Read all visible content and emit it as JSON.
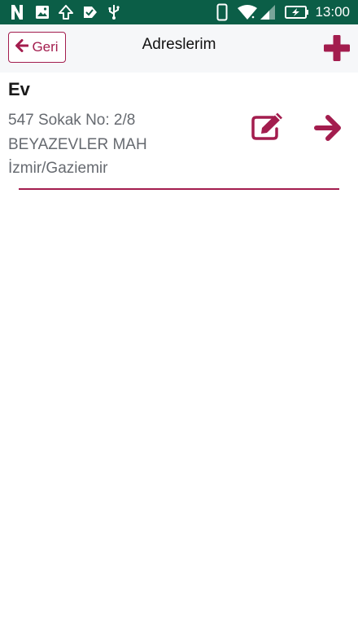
{
  "status_bar": {
    "time": "13:00",
    "icons": [
      "n-app-icon",
      "image-icon",
      "upload-icon",
      "check-app-icon",
      "usb-icon",
      "phone-icon",
      "wifi-icon",
      "signal-icon",
      "battery-charging-icon"
    ]
  },
  "header": {
    "back_label": "Geri",
    "title": "Adreslerim",
    "add_icon": "plus-icon"
  },
  "addresses": [
    {
      "name": "Ev",
      "line1": "547 Sokak No: 2/8",
      "line2": "BEYAZEVLER MAH",
      "line3": "İzmir/Gaziemir"
    }
  ],
  "colors": {
    "status_bar": "#0b5e47",
    "accent": "#a31d4e",
    "header_bg": "#f6f7f9"
  }
}
